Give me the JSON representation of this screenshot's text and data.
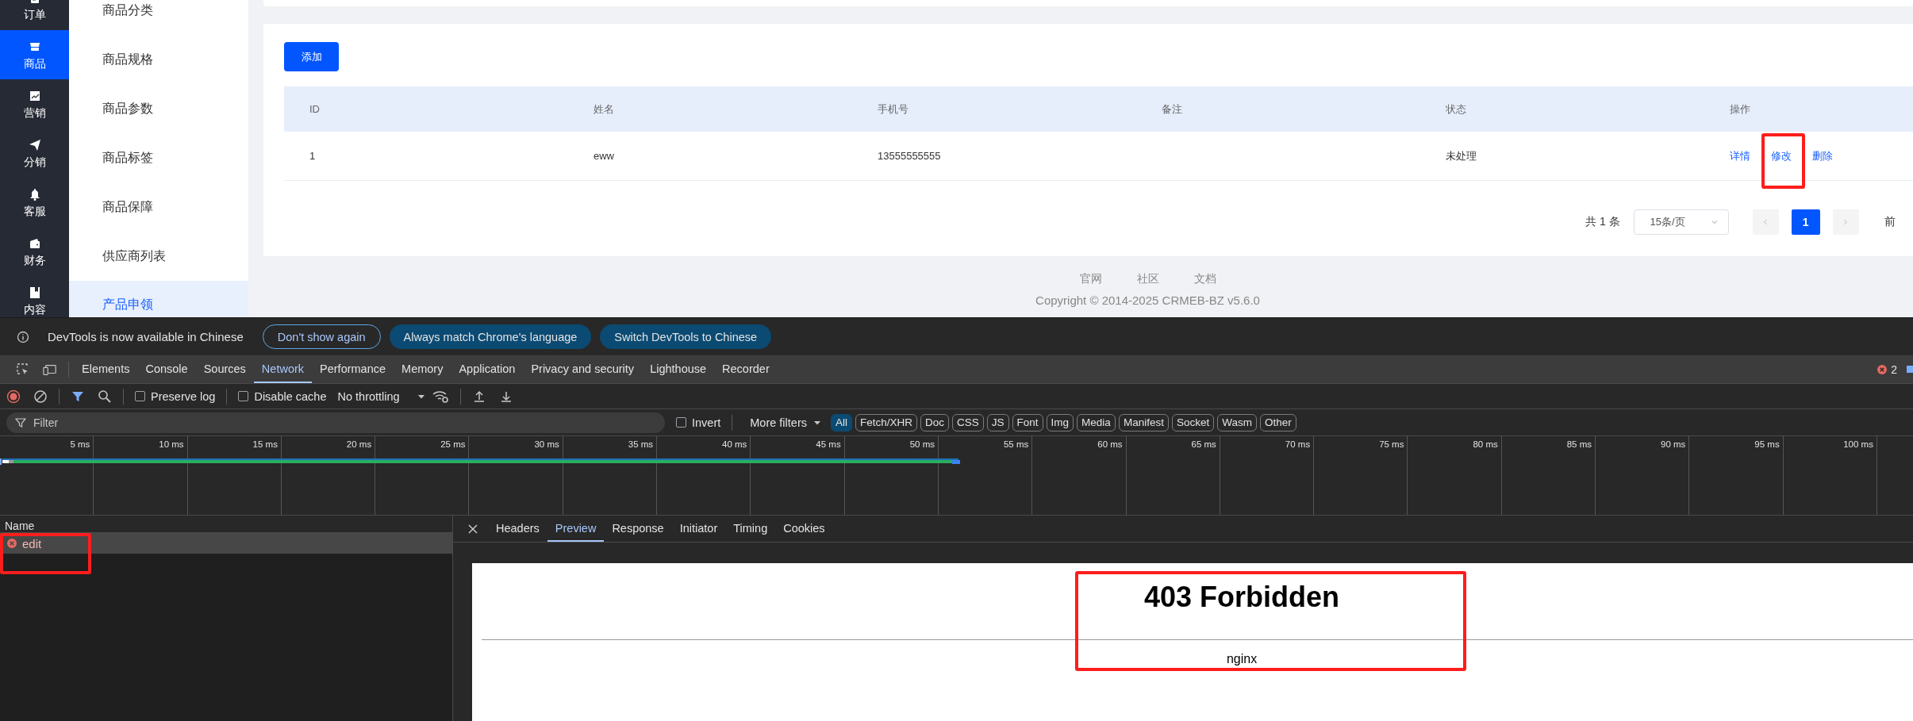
{
  "nav_rail": {
    "items": [
      {
        "label": "订单",
        "selected": false
      },
      {
        "label": "商品",
        "selected": true
      },
      {
        "label": "营销",
        "selected": false
      },
      {
        "label": "分销",
        "selected": false
      },
      {
        "label": "客服",
        "selected": false
      },
      {
        "label": "财务",
        "selected": false
      },
      {
        "label": "内容",
        "selected": false
      }
    ]
  },
  "submenu": {
    "items": [
      {
        "label": "商品分类",
        "selected": false
      },
      {
        "label": "商品规格",
        "selected": false
      },
      {
        "label": "商品参数",
        "selected": false
      },
      {
        "label": "商品标签",
        "selected": false
      },
      {
        "label": "商品保障",
        "selected": false
      },
      {
        "label": "供应商列表",
        "selected": false
      },
      {
        "label": "产品申领",
        "selected": true
      }
    ]
  },
  "add_button": "添加",
  "table": {
    "columns": [
      "ID",
      "姓名",
      "手机号",
      "备注",
      "状态",
      "操作"
    ],
    "rows": [
      {
        "id": "1",
        "name": "eww",
        "phone": "13555555555",
        "status": "未处理",
        "actions": [
          {
            "label": "详情",
            "highlighted": false
          },
          {
            "label": "修改",
            "highlighted": true
          },
          {
            "label": "删除",
            "highlighted": false
          }
        ]
      }
    ]
  },
  "pagination": {
    "total": "共 1 条",
    "page_size": "15条/页",
    "pages": [
      {
        "label": "1",
        "selected": true
      }
    ],
    "jump_label": "前"
  },
  "footer": {
    "links": [
      "官网",
      "社区",
      "文档"
    ],
    "copyright": "Copyright © 2014-2025 CRMEB-BZ v5.6.0"
  },
  "devtools": {
    "banner": {
      "message": "DevTools is now available in Chinese",
      "buttons": [
        {
          "label": "Don't show again",
          "kind": "outline"
        },
        {
          "label": "Always match Chrome's language",
          "kind": "filled"
        },
        {
          "label": "Switch DevTools to Chinese",
          "kind": "filled"
        }
      ]
    },
    "tabs": [
      {
        "label": "Elements",
        "selected": false
      },
      {
        "label": "Console",
        "selected": false
      },
      {
        "label": "Sources",
        "selected": false
      },
      {
        "label": "Network",
        "selected": true
      },
      {
        "label": "Performance",
        "selected": false
      },
      {
        "label": "Memory",
        "selected": false
      },
      {
        "label": "Application",
        "selected": false
      },
      {
        "label": "Privacy and security",
        "selected": false
      },
      {
        "label": "Lighthouse",
        "selected": false
      },
      {
        "label": "Recorder",
        "selected": false
      }
    ],
    "error_count": "2",
    "toolbar": {
      "preserve_log": {
        "label": "Preserve log",
        "checked": false
      },
      "disable_cache": {
        "label": "Disable cache",
        "checked": false
      },
      "throttling": "No throttling"
    },
    "filter": {
      "placeholder": "Filter",
      "invert": {
        "label": "Invert",
        "checked": false
      },
      "more_filters": "More filters",
      "types": [
        {
          "label": "All",
          "selected": true
        },
        {
          "label": "Fetch/XHR",
          "selected": false
        },
        {
          "label": "Doc",
          "selected": false
        },
        {
          "label": "CSS",
          "selected": false
        },
        {
          "label": "JS",
          "selected": false
        },
        {
          "label": "Font",
          "selected": false
        },
        {
          "label": "Img",
          "selected": false
        },
        {
          "label": "Media",
          "selected": false
        },
        {
          "label": "Manifest",
          "selected": false
        },
        {
          "label": "Socket",
          "selected": false
        },
        {
          "label": "Wasm",
          "selected": false
        },
        {
          "label": "Other",
          "selected": false
        }
      ]
    },
    "timeline": {
      "ticks": [
        "5 ms",
        "10 ms",
        "15 ms",
        "20 ms",
        "25 ms",
        "30 ms",
        "35 ms",
        "40 ms",
        "45 ms",
        "50 ms",
        "55 ms",
        "60 ms",
        "65 ms",
        "70 ms",
        "75 ms",
        "80 ms",
        "85 ms",
        "90 ms",
        "95 ms",
        "100 ms"
      ]
    },
    "requests": {
      "column": "Name",
      "items": [
        {
          "name": "edit",
          "failed": true,
          "selected": true,
          "highlighted": true
        }
      ]
    },
    "detail": {
      "tabs": [
        {
          "label": "Headers",
          "selected": false
        },
        {
          "label": "Preview",
          "selected": true
        },
        {
          "label": "Response",
          "selected": false
        },
        {
          "label": "Initiator",
          "selected": false
        },
        {
          "label": "Timing",
          "selected": false
        },
        {
          "label": "Cookies",
          "selected": false
        }
      ],
      "preview": {
        "heading": "403 Forbidden",
        "text": "nginx",
        "highlighted": true
      }
    }
  }
}
